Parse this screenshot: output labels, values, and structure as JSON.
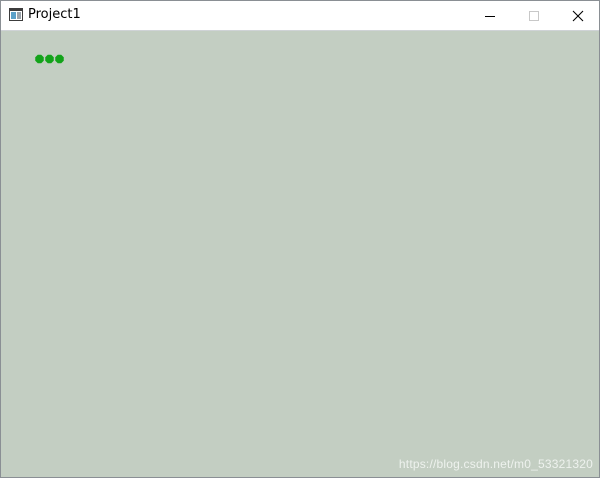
{
  "window": {
    "title": "Project1",
    "app_icon": "window-app-icon",
    "controls": {
      "minimize_icon": "minimize-icon",
      "maximize_icon": "maximize-icon",
      "close_icon": "close-icon"
    }
  },
  "game": {
    "background_color": "#c3cec2",
    "snake_color": "#13a31a",
    "snake_segments": 3
  },
  "watermark": {
    "text": "https://blog.csdn.net/m0_53321320"
  }
}
